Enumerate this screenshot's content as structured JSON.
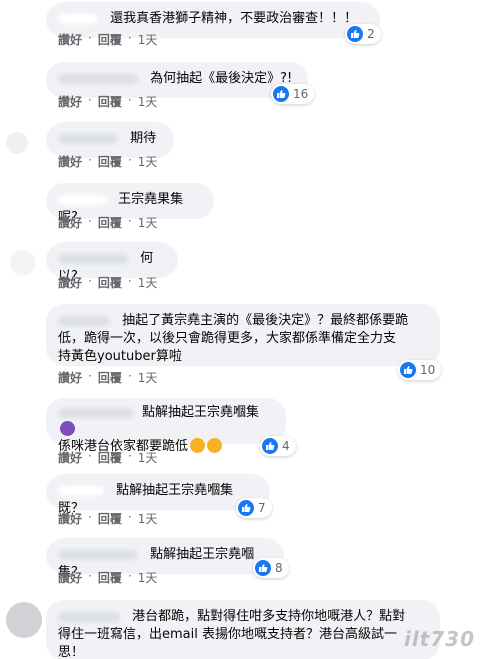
{
  "labels": {
    "like": "讚好",
    "reply": "回覆",
    "dot": "·"
  },
  "comments": [
    {
      "text": "還我真香港獅子精神，不要政治審查！！！",
      "reactions": "2",
      "time": "1天"
    },
    {
      "text": "為何抽起《最後決定》?!",
      "reactions": "16",
      "time": "1天"
    },
    {
      "text": "期待",
      "reactions": "",
      "time": "1天"
    },
    {
      "text": "王宗堯果集呢?",
      "reactions": "",
      "time": "1天"
    },
    {
      "text": "何以?",
      "reactions": "",
      "time": "1天"
    },
    {
      "text": "抽起了黃宗堯主演的《最後決定》？最終都係要跪\n低，跪得一次，以後只會跪得更多，大家都係準備定全力支\n持黃色youtuber算啦",
      "reactions": "10",
      "time": "1天"
    },
    {
      "text": "點解抽起王宗堯嗰集",
      "text2": "係咪港台依家都要跪低",
      "reactions": "4",
      "time": "1天"
    },
    {
      "text": "點解抽起王宗堯嗰集既？",
      "reactions": "7",
      "time": "1天"
    },
    {
      "text": "點解抽起王宗堯嗰集？",
      "reactions": "8",
      "time": "1天"
    },
    {
      "text": "港台都跪，點對得住咁多支持你地嘅港人？點對\n得住一班寫信，出email 表揚你地嘅支持者？港台高級試一\n思！",
      "reactions": "",
      "time": ""
    }
  ],
  "watermark": "ilt730",
  "colors": {
    "bubble": "#f0f2f5",
    "like": "#1877f2",
    "meta": "#65676b"
  }
}
